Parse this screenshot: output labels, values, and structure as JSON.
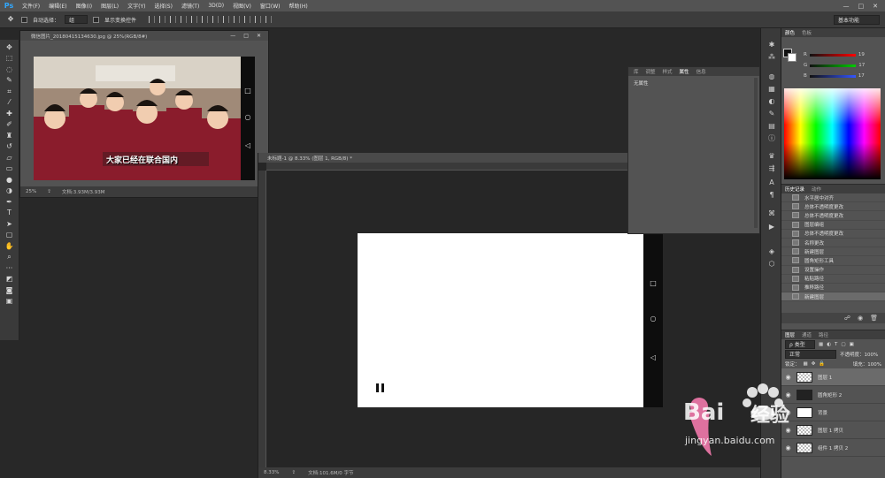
{
  "app": {
    "logo": "Ps"
  },
  "menubar": {
    "items": [
      "文件(F)",
      "编辑(E)",
      "图像(I)",
      "图层(L)",
      "文字(Y)",
      "选择(S)",
      "滤镜(T)",
      "3D(D)",
      "视图(V)",
      "窗口(W)",
      "帮助(H)"
    ],
    "win_controls": [
      "—",
      "□",
      "✕"
    ]
  },
  "options": {
    "auto_select_label": "自动选择：",
    "auto_select_value": "组",
    "show_transform_label": "显示变换控件",
    "workspace": "基本功能"
  },
  "doc1": {
    "tab_title": "微信图片_20180415134630.jpg @ 25%(RGB/8#)",
    "zoom": "25%",
    "doc_info": "文档:3.93M/3.93M",
    "photo_caption": "大家已经在联合国内"
  },
  "main_doc": {
    "tab_title": "未标题-1 @ 8.33% (图层 1, RGB/8) *",
    "zoom": "8.33%",
    "doc_info": "文档:101.6M/0 字节"
  },
  "properties": {
    "tabs": [
      "库",
      "调整",
      "样式",
      "属性",
      "信息"
    ],
    "active_tab": "属性",
    "body": "无属性"
  },
  "color_panel": {
    "tabs": [
      "颜色",
      "色板"
    ],
    "active_tab": "颜色",
    "rows": [
      {
        "label": "R",
        "value": "19",
        "color": "#ff0000"
      },
      {
        "label": "G",
        "value": "17",
        "color": "#00c000"
      },
      {
        "label": "B",
        "value": "17",
        "color": "#3050ff"
      }
    ]
  },
  "history": {
    "tabs": [
      "历史记录",
      "动作"
    ],
    "active_tab": "历史记录",
    "items": [
      "水平居中对齐",
      "总体不透明度更改",
      "总体不透明度更改",
      "图层编组",
      "总体不透明度更改",
      "名称更改",
      "新建图层",
      "圆角矩形工具",
      "设置操作",
      "粘贴路径",
      "推移路径",
      "新建图层"
    ],
    "selected_index": 11
  },
  "layers": {
    "tabs": [
      "图层",
      "通道",
      "路径"
    ],
    "active_tab": "图层",
    "kind_label": "ρ 类型",
    "blend_mode": "正常",
    "opacity_label": "不透明度：100%",
    "lock_label": "锁定：",
    "fill_label": "填充：100%",
    "items": [
      {
        "name": "图层 1",
        "selected": true
      },
      {
        "name": "圆角矩形 2",
        "selected": false
      },
      {
        "name": "背景",
        "selected": false
      },
      {
        "name": "图层 1 拷贝",
        "selected": false
      },
      {
        "name": "组件 1 拷贝 2",
        "selected": false
      }
    ]
  },
  "watermark": {
    "brand": "Bai",
    "brand2": "经验",
    "url": "jingyan.baidu.com"
  }
}
